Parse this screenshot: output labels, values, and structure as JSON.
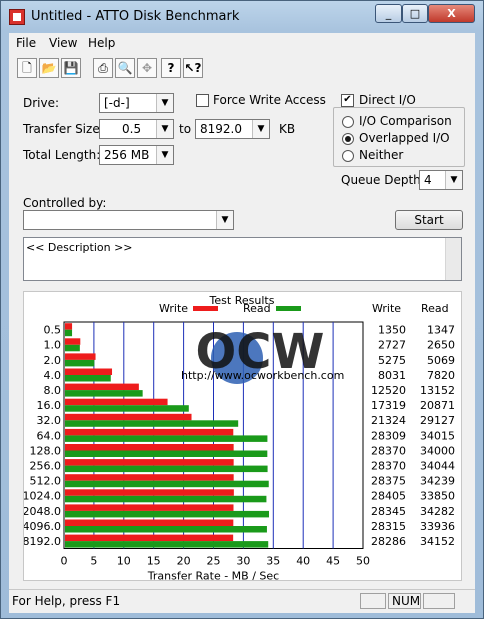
{
  "window": {
    "title": "Untitled - ATTO Disk Benchmark"
  },
  "titlebar_buttons": {
    "minimize": "_",
    "maximize": "□",
    "close": "X"
  },
  "menu": [
    "File",
    "View",
    "Help"
  ],
  "toolbar_icons": [
    "new-icon",
    "open-icon",
    "save-icon",
    "print-icon",
    "print-preview-icon",
    "move-icon",
    "help-icon",
    "context-help-icon"
  ],
  "form": {
    "drive_label": "Drive:",
    "drive_value": "[-d-]",
    "force_write_label": "Force Write Access",
    "force_write_checked": false,
    "direct_io_label": "Direct I/O",
    "direct_io_checked": true,
    "transfer_size_label": "Transfer Size:",
    "transfer_from": "0.5",
    "to_label": "to",
    "transfer_to": "8192.0",
    "kb_label": "KB",
    "total_length_label": "Total Length:",
    "total_length_value": "256 MB",
    "io_comparison_label": "I/O Comparison",
    "overlapped_io_label": "Overlapped I/O",
    "neither_label": "Neither",
    "selected_io_mode": "Overlapped I/O",
    "queue_depth_label": "Queue Depth:",
    "queue_depth_value": "4",
    "controlled_by_label": "Controlled by:",
    "controlled_by_value": "",
    "start_button": "Start",
    "description": "<< Description >>"
  },
  "chart_data": {
    "type": "bar",
    "title": "Test Results",
    "legend": [
      "Write",
      "Read"
    ],
    "colors": {
      "write": "#ee1c1c",
      "read": "#1a9a1a"
    },
    "categories": [
      "0.5",
      "1.0",
      "2.0",
      "4.0",
      "8.0",
      "16.0",
      "32.0",
      "64.0",
      "128.0",
      "256.0",
      "512.0",
      "1024.0",
      "2048.0",
      "4096.0",
      "8192.0"
    ],
    "series": [
      {
        "name": "Write",
        "values": [
          1350,
          2727,
          5275,
          8031,
          12520,
          17319,
          21324,
          28309,
          28370,
          28370,
          28375,
          28405,
          28345,
          28315,
          28286
        ]
      },
      {
        "name": "Read",
        "values": [
          1347,
          2650,
          5069,
          7820,
          13152,
          20871,
          29127,
          34015,
          34000,
          34044,
          34239,
          33850,
          34282,
          33936,
          34152
        ]
      }
    ],
    "column_headers": [
      "Write",
      "Read"
    ],
    "xlabel": "Transfer Rate - MB / Sec",
    "xticks": [
      "0",
      "5",
      "10",
      "15",
      "20",
      "25",
      "30",
      "35",
      "40",
      "45",
      "50"
    ],
    "xlim": [
      0,
      50
    ],
    "grid": true,
    "watermark_url": "http://www.ocworkbench.com",
    "watermark_logo": "OCW"
  },
  "status": {
    "help_text": "For Help, press F1",
    "num": "NUM"
  }
}
